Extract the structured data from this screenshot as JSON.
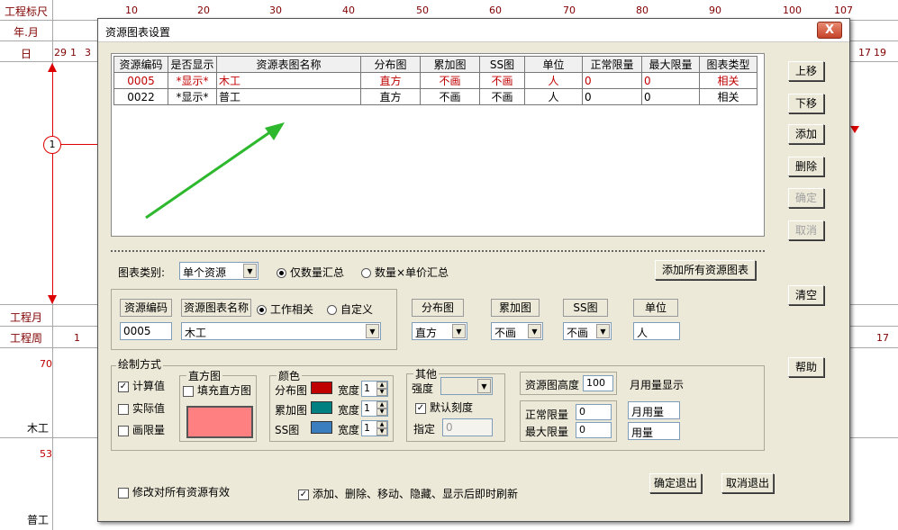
{
  "background": {
    "labels": {
      "ruler": "工程标尺",
      "year_month": "年.月",
      "day": "日",
      "project_month": "工程月",
      "project_week": "工程周"
    },
    "ruler_ticks": [
      "10",
      "20",
      "30",
      "40",
      "50",
      "60",
      "70",
      "80",
      "90",
      "100",
      "107"
    ],
    "day_ticks_left": [
      "29",
      "1",
      "3"
    ],
    "day_ticks_right": [
      "17",
      "19"
    ],
    "week_left": "1",
    "week_right": "17",
    "marker": "1",
    "rows": [
      {
        "value": "70",
        "name": "木工"
      },
      {
        "value": "53",
        "name": "普工"
      }
    ]
  },
  "dialog": {
    "title": "资源图表设置",
    "close": "X",
    "columns": [
      "资源编码",
      "是否显示",
      "资源表图名称",
      "分布图",
      "累加图",
      "SS图",
      "单位",
      "正常限量",
      "最大限量",
      "图表类型"
    ],
    "rows": [
      {
        "code": "0005",
        "show": "*显示*",
        "name": "木工",
        "dist": "直方",
        "cum": "不画",
        "ss": "不画",
        "unit": "人",
        "normal": "0",
        "max": "0",
        "type": "相关"
      },
      {
        "code": "0022",
        "show": "*显示*",
        "name": "普工",
        "dist": "直方",
        "cum": "不画",
        "ss": "不画",
        "unit": "人",
        "normal": "0",
        "max": "0",
        "type": "相关"
      }
    ],
    "side_buttons": {
      "up": "上移",
      "down": "下移",
      "add": "添加",
      "delete": "删除",
      "confirm": "确定",
      "cancel": "取消",
      "clear": "清空",
      "help": "帮助"
    },
    "chart_category_label": "图表类别:",
    "chart_category_value": "单个资源",
    "radio_qty": "仅数量汇总",
    "radio_qty_price": "数量×单价汇总",
    "add_all_button": "添加所有资源图表",
    "detail": {
      "code_label": "资源编码",
      "code_value": "0005",
      "name_label": "资源图表名称",
      "radio_work": "工作相关",
      "radio_custom": "自定义",
      "name_value": "木工",
      "dist_label": "分布图",
      "dist_value": "直方",
      "cum_label": "累加图",
      "cum_value": "不画",
      "ss_label": "SS图",
      "ss_value": "不画",
      "unit_label": "单位",
      "unit_value": "人"
    },
    "draw": {
      "group_label": "绘制方式",
      "calc": "计算值",
      "actual": "实际值",
      "limit": "画限量",
      "hist_label": "直方图",
      "fill_hist": "填充直方图",
      "hist_color": "#ff8080",
      "color_label": "颜色",
      "dist_row": "分布图",
      "cum_row": "累加图",
      "ss_row": "SS图",
      "width_label": "宽度",
      "width_value": "1",
      "dist_color": "#c00000",
      "cum_color": "#008080",
      "ss_color": "#3a7ec0",
      "other_label": "其他",
      "strength_label": "强度",
      "default_scale": "默认刻度",
      "specify_label": "指定",
      "specify_value": "0",
      "height_label": "资源图高度",
      "height_value": "100",
      "month_display": "月用量显示",
      "normal_label": "正常限量",
      "normal_value": "0",
      "max_label": "最大限量",
      "max_value": "0",
      "month_usage": "月用量",
      "usage": "用量"
    },
    "modify_all": "修改对所有资源有效",
    "refresh_immediate": "添加、删除、移动、隐藏、显示后即时刷新",
    "ok_exit": "确定退出",
    "cancel_exit": "取消退出"
  }
}
